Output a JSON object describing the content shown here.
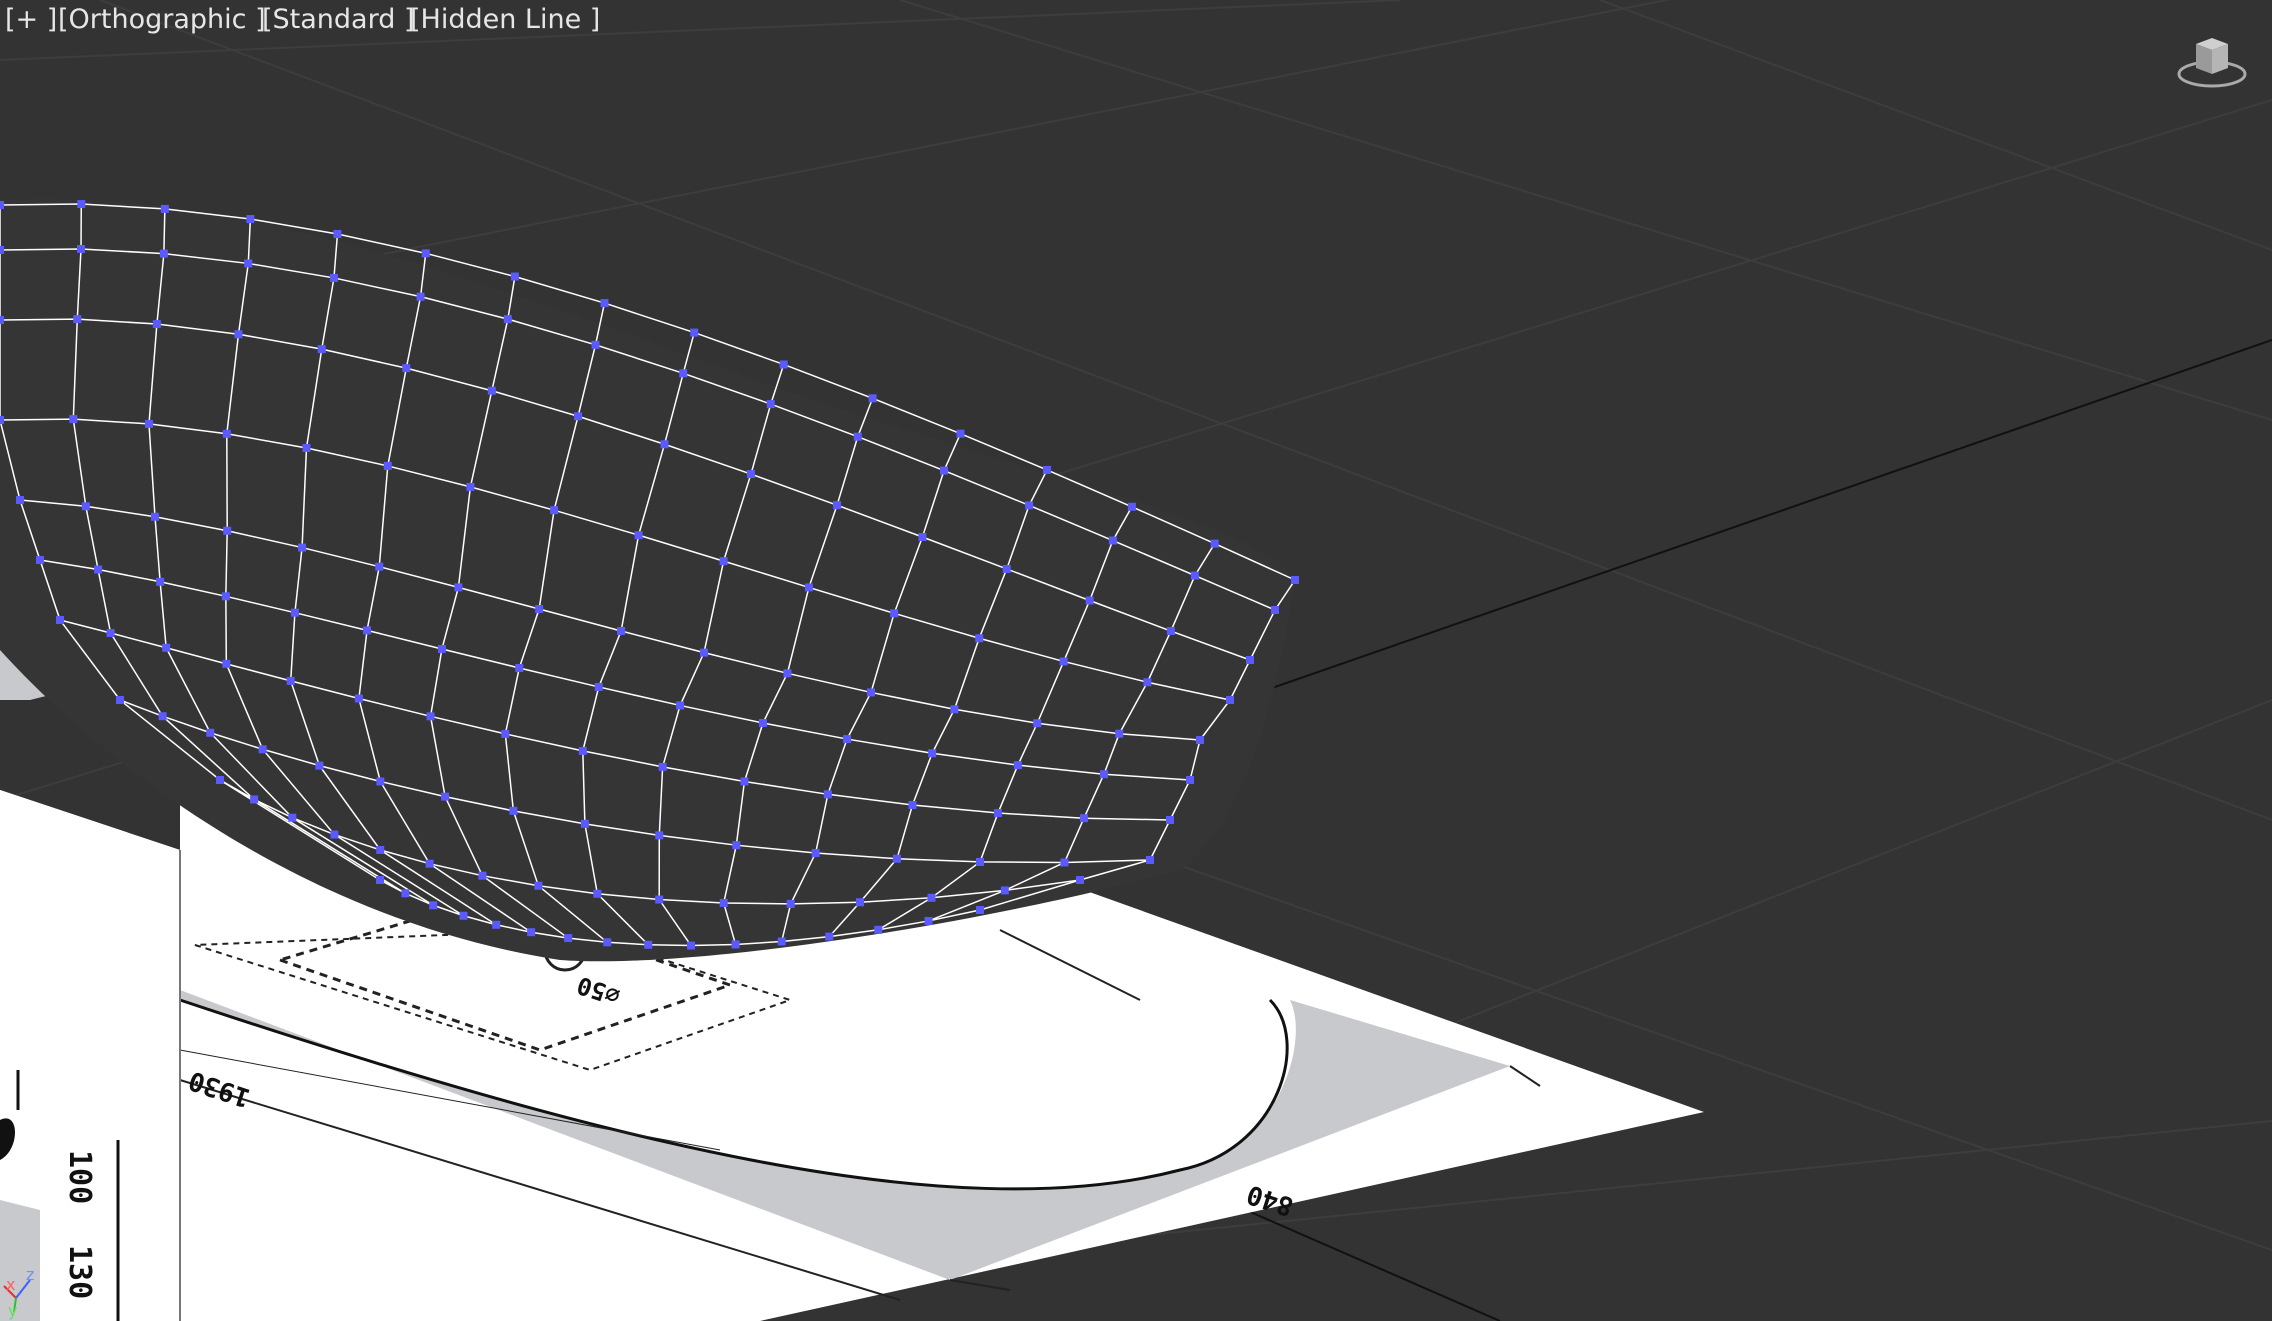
{
  "viewport": {
    "labels": {
      "plus": "[+ ]",
      "projection": "[Orthographic ]",
      "camera_style": "[Standard ]",
      "shading": "[Hidden Line ]"
    },
    "viewcube_icon": "viewcube-icon",
    "axis_tripod": {
      "x": "x",
      "y": "y",
      "z": "z"
    }
  },
  "drawing": {
    "dimensions": {
      "length": "1930",
      "width": "840",
      "drain": "⌀50",
      "side_a": "100",
      "side_b": "130"
    }
  },
  "colors": {
    "background": "#333333",
    "mesh_vertex": "#5a5aff",
    "mesh_edge": "#ffffff",
    "paper": "#ffffff",
    "paper_shade": "#c8c9cc"
  }
}
